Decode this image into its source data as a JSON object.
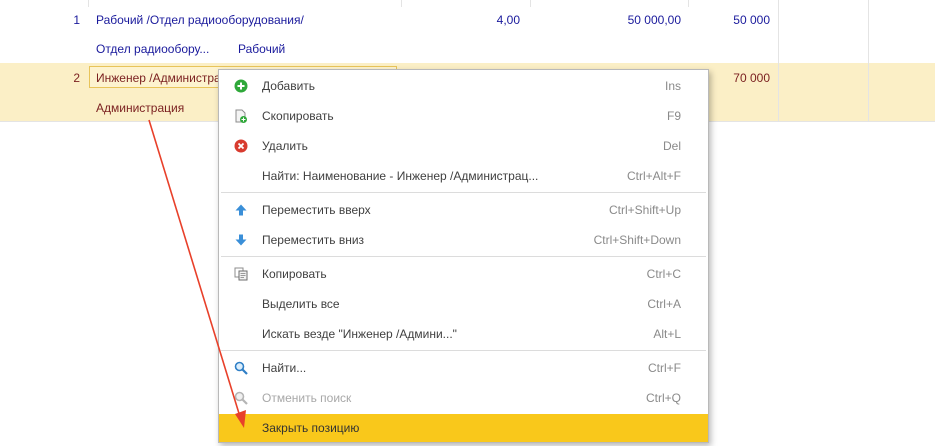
{
  "table": {
    "rows": [
      {
        "num": "1",
        "name": "Рабочий /Отдел радиооборудования/",
        "department": "Отдел радиообору...",
        "position": "Рабочий",
        "quantity": "4,00",
        "salary": "50 000,00",
        "total": "50 000"
      },
      {
        "num": "2",
        "name": "Инженер /Администрация/",
        "department": "Администрация",
        "total": "70 000"
      }
    ]
  },
  "context_menu": {
    "items": [
      {
        "label": "Добавить",
        "shortcut": "Ins",
        "icon": "add-icon",
        "enabled": true
      },
      {
        "label": "Скопировать",
        "shortcut": "F9",
        "icon": "copy-row-icon",
        "enabled": true
      },
      {
        "label": "Удалить",
        "shortcut": "Del",
        "icon": "delete-icon",
        "enabled": true
      },
      {
        "label": "Найти: Наименование - Инженер /Администрац...",
        "shortcut": "Ctrl+Alt+F",
        "icon": "",
        "enabled": true
      },
      {
        "label": "Переместить вверх",
        "shortcut": "Ctrl+Shift+Up",
        "icon": "arrow-up-icon",
        "enabled": true
      },
      {
        "label": "Переместить вниз",
        "shortcut": "Ctrl+Shift+Down",
        "icon": "arrow-down-icon",
        "enabled": true
      },
      {
        "label": "Копировать",
        "shortcut": "Ctrl+C",
        "icon": "clipboard-copy-icon",
        "enabled": true
      },
      {
        "label": "Выделить все",
        "shortcut": "Ctrl+A",
        "icon": "",
        "enabled": true
      },
      {
        "label": "Искать везде \"Инженер /Админи...\"",
        "shortcut": "Alt+L",
        "icon": "",
        "enabled": true
      },
      {
        "label": "Найти...",
        "shortcut": "Ctrl+F",
        "icon": "search-icon",
        "enabled": true
      },
      {
        "label": "Отменить поиск",
        "shortcut": "Ctrl+Q",
        "icon": "cancel-search-icon",
        "enabled": false
      },
      {
        "label": "Закрыть позицию",
        "shortcut": "",
        "icon": "",
        "enabled": true,
        "highlighted": true
      }
    ]
  },
  "colors": {
    "selected_row": "#fbefc6",
    "menu_highlight": "#f9c81b",
    "annotation_arrow": "#e8402a",
    "row_text": "#1a1a9c"
  }
}
